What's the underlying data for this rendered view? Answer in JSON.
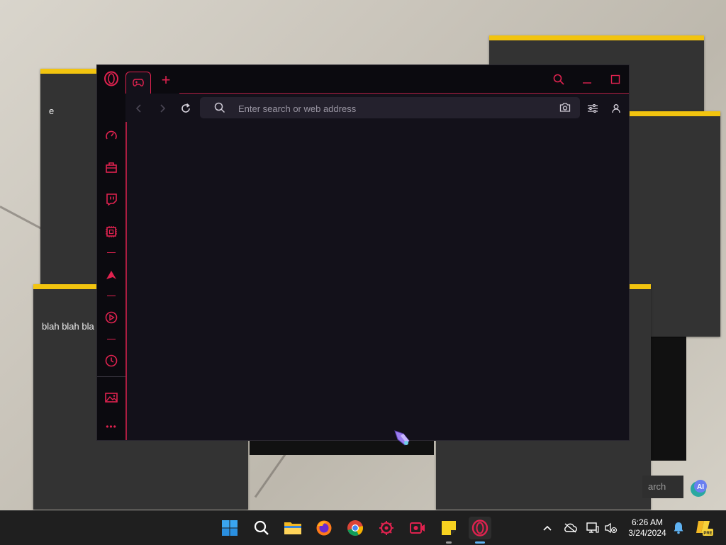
{
  "notes": [
    {
      "text": "e"
    },
    {
      "text": "blah blah bla"
    },
    {
      "text": ""
    },
    {
      "text": ""
    },
    {
      "text": ""
    }
  ],
  "browser": {
    "tab_icon": "gamepad-icon",
    "new_tab_label": "+",
    "address_placeholder": "Enter search or web address",
    "address_value": "",
    "accent_color": "#e0224f",
    "sidebar_items": [
      {
        "icon": "speed-dial-icon"
      },
      {
        "icon": "bag-icon"
      },
      {
        "icon": "twitch-icon"
      },
      {
        "icon": "cpu-icon"
      },
      {
        "icon": "aria-icon"
      },
      {
        "icon": "player-icon"
      },
      {
        "icon": "history-icon"
      },
      {
        "icon": "gallery-icon"
      },
      {
        "icon": "more-icon",
        "label": "•••"
      }
    ]
  },
  "desktop_search": {
    "label": "arch"
  },
  "ai_badge": {
    "label": "AI"
  },
  "taskbar": {
    "apps": [
      "start-icon",
      "search-icon",
      "file-explorer-icon",
      "firefox-icon",
      "chrome-icon",
      "gx-control-icon",
      "screen-recorder-icon",
      "sticky-notes-icon",
      "opera-gx-icon"
    ],
    "time": "6:26 AM",
    "date": "3/24/2024",
    "copilot_badge": "PRE"
  }
}
